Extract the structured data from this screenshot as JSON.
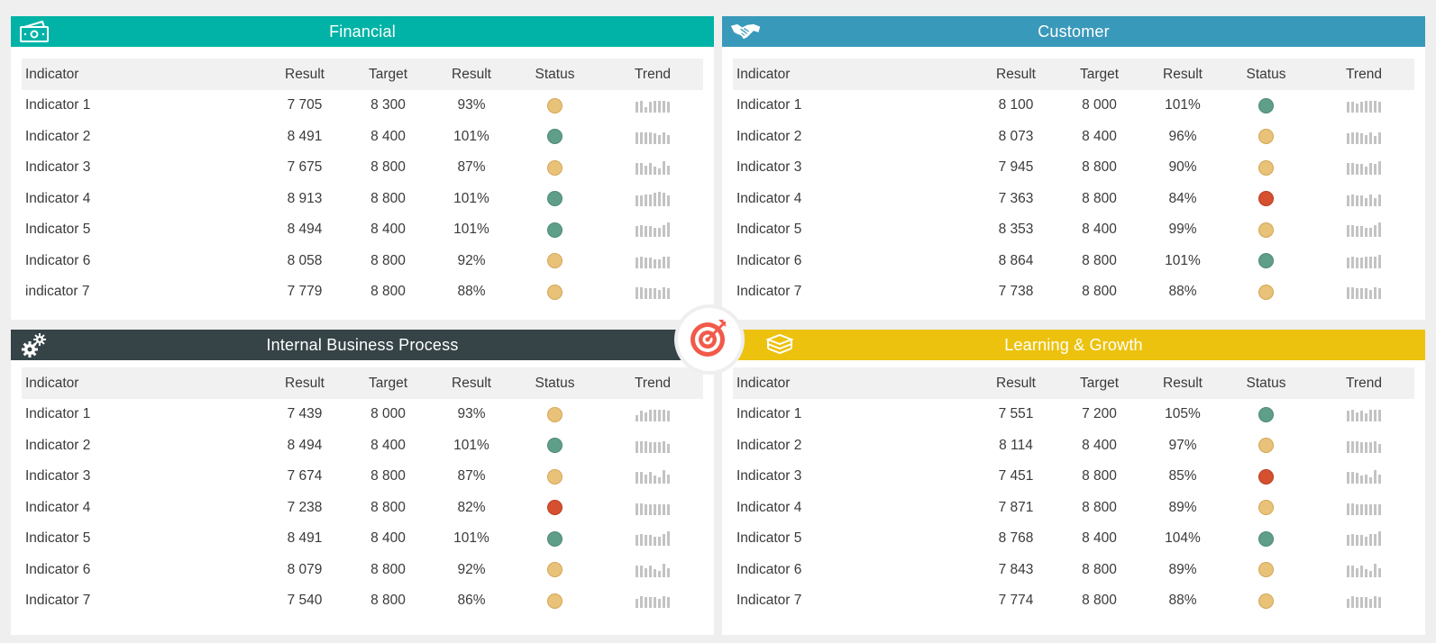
{
  "colors": {
    "financial": "#00b3a6",
    "customer": "#3999ba",
    "internal": "#364448",
    "learning": "#ecc20e",
    "status_amber": "#e9c27a",
    "status_green": "#5f9f8a",
    "status_red": "#d4502f"
  },
  "columns": {
    "indicator": "Indicator",
    "result": "Result",
    "target": "Target",
    "result_pct": "Result",
    "status": "Status",
    "trend": "Trend"
  },
  "panels": {
    "financial": {
      "title": "Financial",
      "icon": "money-icon",
      "rows": [
        {
          "name": "Indicator 1",
          "result": "7 705",
          "target": "8 300",
          "pct": "93%",
          "status": "amber",
          "trend": [
            8,
            9,
            4,
            8,
            9,
            9,
            9,
            8
          ]
        },
        {
          "name": "Indicator 2",
          "result": "8 491",
          "target": "8 400",
          "pct": "101%",
          "status": "green",
          "trend": [
            9,
            9,
            9,
            9,
            8,
            7,
            9,
            7
          ]
        },
        {
          "name": "Indicator 3",
          "result": "7 675",
          "target": "8 800",
          "pct": "87%",
          "status": "amber",
          "trend": [
            9,
            9,
            7,
            9,
            6,
            5,
            10,
            7
          ]
        },
        {
          "name": "Indicator 4",
          "result": "8 913",
          "target": "8 800",
          "pct": "101%",
          "status": "green",
          "trend": [
            8,
            8,
            9,
            9,
            10,
            11,
            10,
            8
          ]
        },
        {
          "name": "Indicator 5",
          "result": "8 494",
          "target": "8 400",
          "pct": "101%",
          "status": "green",
          "trend": [
            8,
            9,
            8,
            8,
            7,
            7,
            9,
            11
          ]
        },
        {
          "name": "Indicator 6",
          "result": "8 058",
          "target": "8 800",
          "pct": "92%",
          "status": "amber",
          "trend": [
            8,
            9,
            8,
            8,
            7,
            7,
            9,
            9
          ]
        },
        {
          "name": "indicator 7",
          "result": "7 779",
          "target": "8 800",
          "pct": "88%",
          "status": "amber",
          "trend": [
            9,
            9,
            8,
            8,
            8,
            7,
            9,
            8
          ]
        }
      ]
    },
    "customer": {
      "title": "Customer",
      "icon": "handshake-icon",
      "rows": [
        {
          "name": "Indicator 1",
          "result": "8 100",
          "target": "8 000",
          "pct": "101%",
          "status": "green",
          "trend": [
            8,
            8,
            7,
            8,
            9,
            9,
            9,
            8
          ]
        },
        {
          "name": "Indicator 2",
          "result": "8 073",
          "target": "8 400",
          "pct": "96%",
          "status": "amber",
          "trend": [
            8,
            9,
            9,
            8,
            7,
            9,
            6,
            9
          ]
        },
        {
          "name": "Indicator 3",
          "result": "7 945",
          "target": "8 800",
          "pct": "90%",
          "status": "amber",
          "trend": [
            9,
            9,
            8,
            8,
            6,
            9,
            8,
            10
          ]
        },
        {
          "name": "Indicator 4",
          "result": "7 363",
          "target": "8 800",
          "pct": "84%",
          "status": "red",
          "trend": [
            8,
            9,
            8,
            8,
            6,
            9,
            6,
            9
          ]
        },
        {
          "name": "Indicator 5",
          "result": "8 353",
          "target": "8 400",
          "pct": "99%",
          "status": "amber",
          "trend": [
            9,
            9,
            8,
            8,
            7,
            7,
            9,
            11
          ]
        },
        {
          "name": "Indicator 6",
          "result": "8 864",
          "target": "8 800",
          "pct": "101%",
          "status": "green",
          "trend": [
            8,
            9,
            8,
            8,
            9,
            9,
            9,
            10
          ]
        },
        {
          "name": "Indicator 7",
          "result": "7 738",
          "target": "8 800",
          "pct": "88%",
          "status": "amber",
          "trend": [
            9,
            9,
            8,
            8,
            8,
            7,
            9,
            8
          ]
        }
      ]
    },
    "internal": {
      "title": "Internal Business Process",
      "icon": "gears-icon",
      "rows": [
        {
          "name": "Indicator 1",
          "result": "7 439",
          "target": "8 000",
          "pct": "93%",
          "status": "amber",
          "trend": [
            5,
            8,
            7,
            9,
            9,
            9,
            9,
            8
          ]
        },
        {
          "name": "Indicator 2",
          "result": "8 494",
          "target": "8 400",
          "pct": "101%",
          "status": "green",
          "trend": [
            9,
            9,
            9,
            8,
            8,
            8,
            9,
            7
          ]
        },
        {
          "name": "Indicator 3",
          "result": "7 674",
          "target": "8 800",
          "pct": "87%",
          "status": "amber",
          "trend": [
            9,
            9,
            7,
            9,
            6,
            5,
            10,
            7
          ]
        },
        {
          "name": "Indicator 4",
          "result": "7 238",
          "target": "8 800",
          "pct": "82%",
          "status": "red",
          "trend": [
            9,
            9,
            8,
            8,
            8,
            8,
            8,
            8
          ]
        },
        {
          "name": "Indicator 5",
          "result": "8 491",
          "target": "8 400",
          "pct": "101%",
          "status": "green",
          "trend": [
            8,
            9,
            8,
            8,
            7,
            7,
            9,
            11
          ]
        },
        {
          "name": "Indicator 6",
          "result": "8 079",
          "target": "8 800",
          "pct": "92%",
          "status": "amber",
          "trend": [
            9,
            9,
            7,
            9,
            6,
            5,
            10,
            7
          ]
        },
        {
          "name": "Indicator 7",
          "result": "7 540",
          "target": "8 800",
          "pct": "86%",
          "status": "amber",
          "trend": [
            7,
            9,
            8,
            8,
            8,
            7,
            9,
            8
          ]
        }
      ]
    },
    "learning": {
      "title": "Learning & Growth",
      "icon": "books-icon",
      "rows": [
        {
          "name": "Indicator 1",
          "result": "7 551",
          "target": "7 200",
          "pct": "105%",
          "status": "green",
          "trend": [
            8,
            9,
            7,
            8,
            6,
            9,
            9,
            9
          ]
        },
        {
          "name": "Indicator 2",
          "result": "8 114",
          "target": "8 400",
          "pct": "97%",
          "status": "amber",
          "trend": [
            9,
            9,
            9,
            8,
            8,
            8,
            9,
            7
          ]
        },
        {
          "name": "Indicator 3",
          "result": "7 451",
          "target": "8 800",
          "pct": "85%",
          "status": "red",
          "trend": [
            9,
            9,
            8,
            6,
            7,
            5,
            10,
            7
          ]
        },
        {
          "name": "Indicator 4",
          "result": "7 871",
          "target": "8 800",
          "pct": "89%",
          "status": "amber",
          "trend": [
            9,
            9,
            8,
            8,
            8,
            8,
            8,
            8
          ]
        },
        {
          "name": "Indicator 5",
          "result": "8 768",
          "target": "8 400",
          "pct": "104%",
          "status": "green",
          "trend": [
            8,
            9,
            8,
            8,
            7,
            9,
            9,
            11
          ]
        },
        {
          "name": "Indicator 6",
          "result": "7 843",
          "target": "8 800",
          "pct": "89%",
          "status": "amber",
          "trend": [
            9,
            9,
            7,
            9,
            6,
            5,
            10,
            7
          ]
        },
        {
          "name": "Indicator 7",
          "result": "7 774",
          "target": "8 800",
          "pct": "88%",
          "status": "amber",
          "trend": [
            7,
            9,
            8,
            8,
            8,
            7,
            9,
            8
          ]
        }
      ]
    }
  },
  "center_icon": "target-icon"
}
